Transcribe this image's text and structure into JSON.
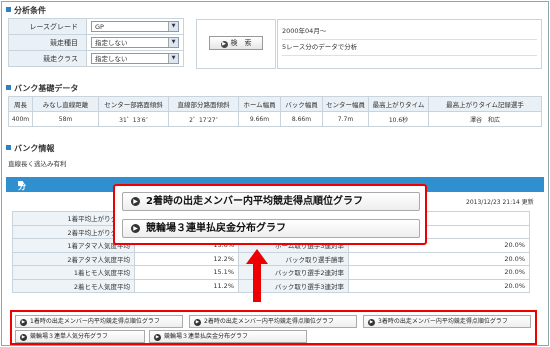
{
  "sections": {
    "conditions_title": "分析条件",
    "bank_title": "バンク基礎データ",
    "bankinfo_title": "バンク情報",
    "result_title": "分析結果"
  },
  "conditions": {
    "rows": [
      {
        "label": "レースグレード",
        "value": "GP"
      },
      {
        "label": "競走種目",
        "value": "指定しない"
      },
      {
        "label": "競走クラス",
        "value": "指定しない"
      }
    ],
    "search_label": "検　索",
    "info_lines": [
      "2000年04月～",
      "5レース分のデータで分析"
    ]
  },
  "bank": {
    "headers": [
      "周長",
      "みなし直線距離",
      "センター部路面傾斜",
      "直線部分路面傾斜",
      "ホーム幅員",
      "バック幅員",
      "センター幅員",
      "最高上がりタイム",
      "最高上がりタイム記録選手"
    ],
    "values": [
      "400m",
      "58m",
      "31゜13′6″",
      "2゜17′27″",
      "9.66m",
      "8.66m",
      "7.7m",
      "10.6秒",
      "澤谷　和広"
    ]
  },
  "bankinfo": {
    "text": "直線長く逃込み有利"
  },
  "result": {
    "timestamp": "2013/12/23 21:14 更新",
    "rows": [
      {
        "label": "1着平均上がりタイム",
        "value": "",
        "label2": "",
        "value2": ""
      },
      {
        "label": "2着平均上がりタイム",
        "value": "",
        "label2": "",
        "value2": ""
      },
      {
        "label": "1着アタマ人気度平均",
        "value": "15.6%",
        "label2": "ホーム取り選手3連対率",
        "value2": "20.0%"
      },
      {
        "label": "2着アタマ人気度平均",
        "value": "12.2%",
        "label2": "バック取り選手勝率",
        "value2": "20.0%"
      },
      {
        "label": "1着ヒモ人気度平均",
        "value": "15.1%",
        "label2": "バック取り選手2連対率",
        "value2": "20.0%"
      },
      {
        "label": "2着ヒモ人気度平均",
        "value": "11.2%",
        "label2": "バック取り選手3連対率",
        "value2": "20.0%"
      }
    ]
  },
  "popup": {
    "buttons": [
      "2着時の出走メンバー内平均競走得点順位グラフ",
      "競輪場３連単払戻金分布グラフ"
    ]
  },
  "graph_buttons": [
    "1着時の出走メンバー内平均競走得点順位グラフ",
    "2着時の出走メンバー内平均競走得点順位グラフ",
    "3着時の出走メンバー内平均競走得点順位グラフ",
    "競輪場３連単人気分布グラフ",
    "競輪場３連単払戻金分布グラフ"
  ],
  "colors": {
    "accent": "#2f8fcf",
    "highlight": "#ee0000"
  }
}
